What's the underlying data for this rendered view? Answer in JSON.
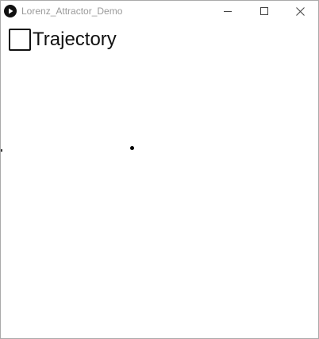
{
  "window": {
    "title": "Lorenz_Attractor_Demo"
  },
  "titlebar_buttons": {
    "minimize_icon": "minimize-icon",
    "maximize_icon": "maximize-icon",
    "close_icon": "close-icon"
  },
  "controls": {
    "trajectory_checkbox_label": "Trajectory",
    "trajectory_checked": false
  },
  "colors": {
    "background": "#ffffff",
    "foreground": "#111111",
    "title_text": "#999999"
  }
}
